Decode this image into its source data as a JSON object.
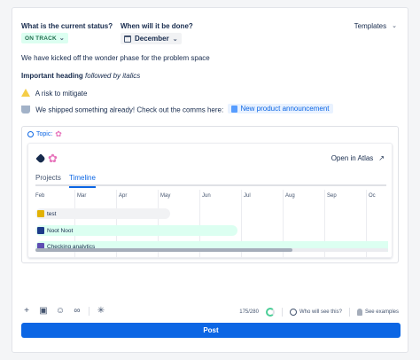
{
  "header": {
    "status_question": "What is the current status?",
    "status_value": "ON TRACK",
    "due_question": "When will it be done?",
    "due_value": "December",
    "templates_label": "Templates"
  },
  "body": {
    "intro": "We have kicked off the wonder phase for the problem space",
    "heading_bold": "Important heading",
    "heading_italic": "followed by italics",
    "risk": "A risk to mitigate",
    "shipped": "We shipped something already! Check out the comms here:",
    "link_label": "New product announcement"
  },
  "embed": {
    "topic_label": "Topic:",
    "open_label": "Open in Atlas",
    "tabs": [
      {
        "label": "Projects"
      },
      {
        "label": "Timeline"
      }
    ],
    "months": [
      "Feb",
      "Mar",
      "Apr",
      "May",
      "Jun",
      "Jul",
      "Aug",
      "Sep",
      "Oc"
    ],
    "rows": [
      {
        "name": "test",
        "icon_color": "#e2b203",
        "bar_color": "#f1f2f4"
      },
      {
        "name": "Noot Noot",
        "icon_color": "#1d3b8a",
        "bar_color": "#dcfff1"
      },
      {
        "name": "Checking analytics",
        "icon_color": "#5e4db2",
        "bar_color": "#dcfff1"
      }
    ]
  },
  "footer": {
    "char_count": "175/280",
    "who_label": "Who will see this?",
    "examples_label": "See examples",
    "post_label": "Post"
  },
  "colors": {
    "accent": "#0c66e4",
    "on_track_bg": "#dcfff1",
    "on_track_text": "#216e4e"
  }
}
